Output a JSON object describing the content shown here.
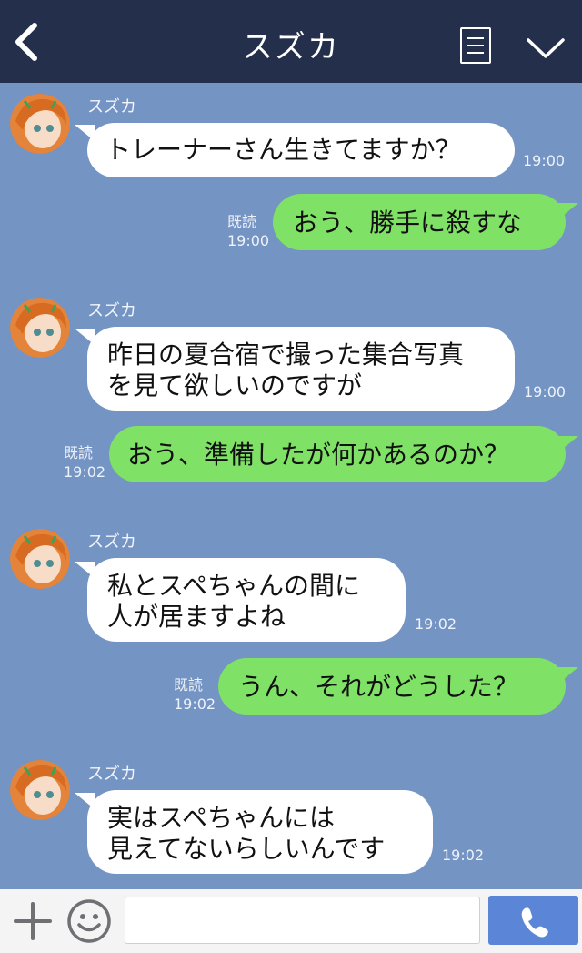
{
  "header": {
    "title": "スズカ",
    "bg_color": "#232f4b",
    "icons": {
      "back": "chevron-left-icon",
      "menu": "menu-lines-icon",
      "expand": "chevron-down-icon"
    }
  },
  "chat": {
    "bg_color": "#7494c4",
    "incoming_bubble_color": "#ffffff",
    "outgoing_bubble_color": "#7fe165",
    "messages": [
      {
        "direction": "in",
        "sender": "スズカ",
        "text": "トレーナーさん生きてますか？",
        "time": "19:00"
      },
      {
        "direction": "out",
        "read": "既読",
        "time": "19:00",
        "text": "おう、勝手に殺すな"
      },
      {
        "direction": "in",
        "sender": "スズカ",
        "text": "昨日の夏合宿で撮った集合写真\nを見て欲しいのですが",
        "time": "19:00"
      },
      {
        "direction": "out",
        "read": "既読",
        "time": "19:02",
        "text": "おう、準備したが何かあるのか？"
      },
      {
        "direction": "in",
        "sender": "スズカ",
        "text": "私とスペちゃんの間に\n人が居ますよね",
        "time": "19:02"
      },
      {
        "direction": "out",
        "read": "既読",
        "time": "19:02",
        "text": "うん、それがどうした？"
      },
      {
        "direction": "in",
        "sender": "スズカ",
        "text": "実はスペちゃんには\n見えてないらしいんです",
        "time": "19:02"
      }
    ]
  },
  "footer": {
    "input_value": "",
    "input_placeholder": "",
    "icons": {
      "plus": "plus-icon",
      "emoji": "smiley-icon",
      "send": "phone-icon"
    },
    "send_color": "#5b86d8"
  }
}
